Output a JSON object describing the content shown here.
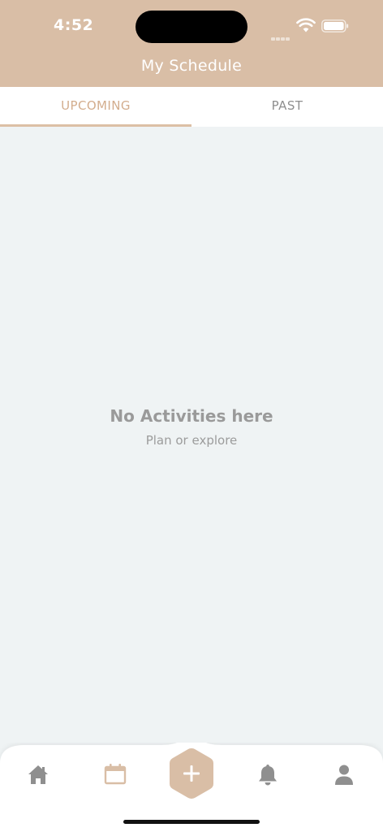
{
  "status_bar": {
    "time": "4:52"
  },
  "header": {
    "title": "My Schedule"
  },
  "tabs": [
    {
      "label": "UPCOMING",
      "selected": true
    },
    {
      "label": "PAST",
      "selected": false
    }
  ],
  "empty_state": {
    "title": "No Activities here",
    "subtitle": "Plan or explore"
  },
  "bottom_nav": {
    "items": [
      "home-icon",
      "calendar-icon",
      "add-icon",
      "bell-icon",
      "profile-icon"
    ],
    "active": "calendar-icon"
  },
  "colors": {
    "accent": "#d9bea6",
    "active_tab_text": "#d3ad8d",
    "background": "#eff3f4",
    "inactive_icon": "#8f8f8f"
  }
}
